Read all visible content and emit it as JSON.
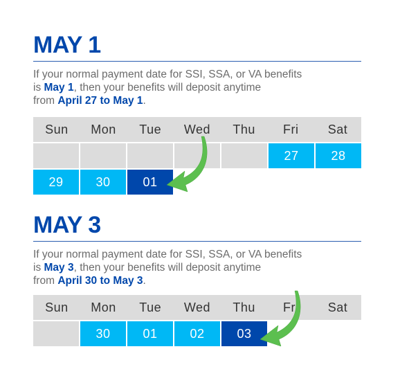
{
  "colors": {
    "title": "#0047ab",
    "highlight_light": "#00b8f5",
    "highlight_dark": "#0047ab",
    "empty_cell": "#dcdcdc",
    "arrow": "#5cbf4f"
  },
  "weekdays": [
    "Sun",
    "Mon",
    "Tue",
    "Wed",
    "Thu",
    "Fri",
    "Sat"
  ],
  "sections": [
    {
      "title": "MAY 1",
      "desc_line1": "If your normal payment date for SSI, SSA, or VA benefits",
      "desc_pre": "is ",
      "desc_bold1": "May 1",
      "desc_mid": ", then your benefits will deposit anytime",
      "desc_from": "from ",
      "desc_bold2": "April 27 to May 1",
      "desc_end": ".",
      "rows": [
        [
          "",
          "",
          "",
          "",
          "",
          "27",
          "28"
        ],
        [
          "29",
          "30",
          "01"
        ]
      ]
    },
    {
      "title": "MAY 3",
      "desc_line1": "If your normal payment date for SSI, SSA, or VA benefits",
      "desc_pre": "is ",
      "desc_bold1": "May 3",
      "desc_mid": ", then your benefits will deposit anytime",
      "desc_from": "from ",
      "desc_bold2": "April 30 to May 3",
      "desc_end": ".",
      "rows": [
        [
          "",
          "30",
          "01",
          "02",
          "03"
        ]
      ]
    }
  ]
}
